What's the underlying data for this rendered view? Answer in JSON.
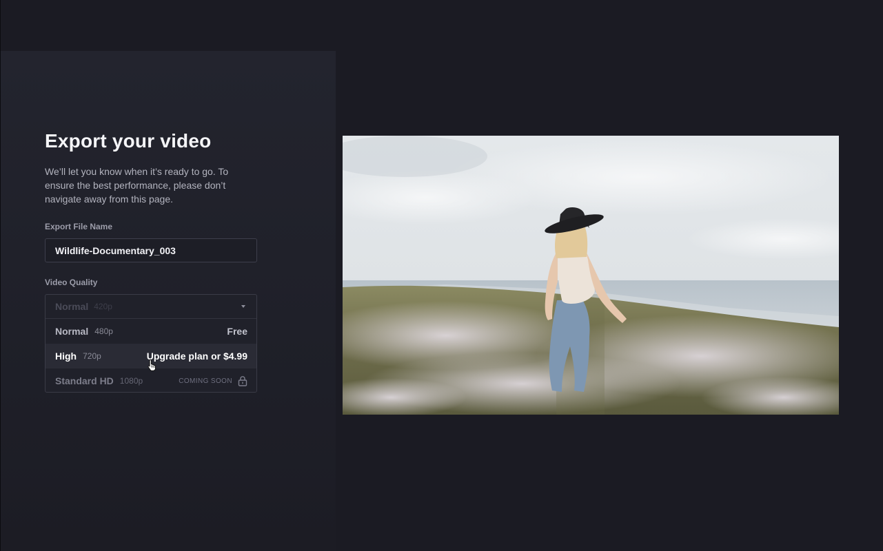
{
  "title": "Export your video",
  "description": "We’ll let you know when it’s ready to go. To ensure the best performance, please don’t navigate away from this page.",
  "filename": {
    "label": "Export File Name",
    "value": "Wildlife-Documentary_003"
  },
  "quality": {
    "label": "Video Quality",
    "selected": {
      "name": "Normal",
      "resolution": "420p"
    },
    "options": [
      {
        "name": "Normal",
        "resolution": "480p",
        "right": "Free"
      },
      {
        "name": "High",
        "resolution": "720p",
        "right": "Upgrade plan or $4.99"
      },
      {
        "name": "Standard HD",
        "resolution": "1080p",
        "right": "COMING SOON",
        "locked": true
      }
    ]
  },
  "icons": {
    "caret": "chevron-down-icon",
    "lock": "lock-icon",
    "cursor": "hand-pointer-cursor"
  },
  "colors": {
    "background": "#1b1b23",
    "panel": "#23242e",
    "hover_row": "#2a2b35"
  }
}
